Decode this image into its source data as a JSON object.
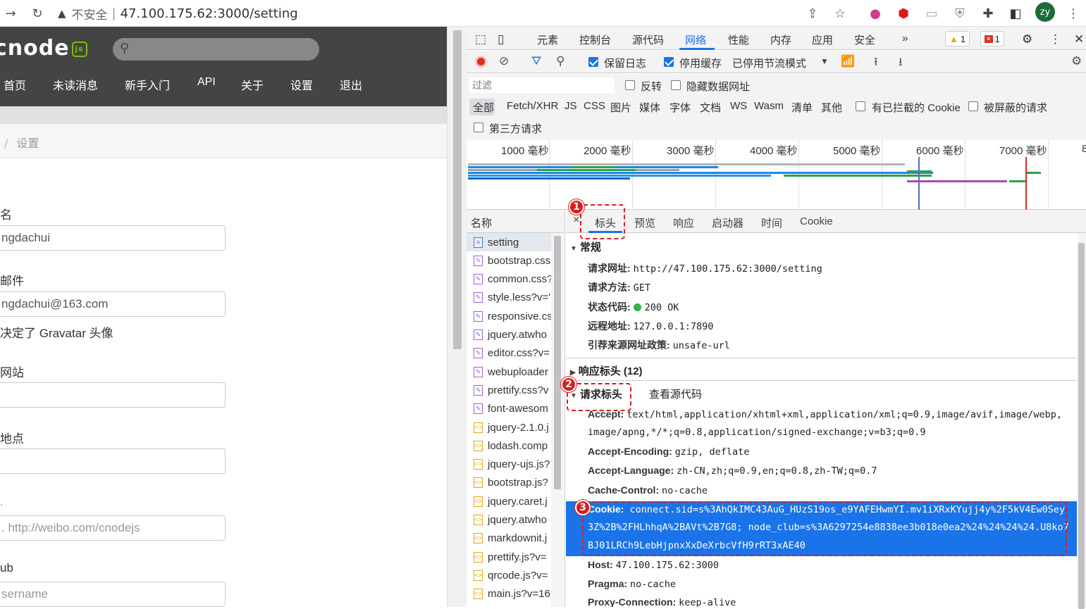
{
  "browser": {
    "insecure_label": "不安全",
    "url": "47.100.175.62:3000/setting",
    "profile_initials": "zy"
  },
  "cnode": {
    "logo": "cnode",
    "logo_js": "js",
    "nav": [
      "首页",
      "未读消息",
      "新手入门",
      "API",
      "关于",
      "设置",
      "退出"
    ],
    "breadcrumb_sep": "/",
    "breadcrumb": "设置",
    "fields": [
      {
        "label": "名",
        "value": "ngdachui",
        "placeholder": false
      },
      {
        "label": "邮件",
        "value": "ngdachui@163.com",
        "placeholder": false
      },
      {
        "label": "决定了 Gravatar 头像",
        "value": null,
        "placeholder": false
      },
      {
        "label": "网站",
        "value": "",
        "placeholder": false
      },
      {
        "label": "地点",
        "value": "",
        "placeholder": false
      },
      {
        "label": "",
        "value": ". http://weibo.com/cnodejs",
        "placeholder": true
      },
      {
        "label": "ub",
        "value": "sername",
        "placeholder": true
      }
    ]
  },
  "devtools": {
    "tabs": [
      "元素",
      "控制台",
      "源代码",
      "网络",
      "性能",
      "内存",
      "应用",
      "安全",
      "»"
    ],
    "active_tab": "网络",
    "warnings": "1",
    "errors": "1",
    "toolbar": {
      "preserve_log": "保留日志",
      "disable_cache": "停用缓存",
      "throttle": "已停用节流模式"
    },
    "filter": {
      "placeholder": "过滤",
      "invert": "反转",
      "hide_data_urls": "隐藏数据网址",
      "types": [
        "全部",
        "Fetch/XHR",
        "JS",
        "CSS",
        "图片",
        "媒体",
        "字体",
        "文档",
        "WS",
        "Wasm",
        "清单",
        "其他"
      ],
      "blocked_cookies": "有已拦截的 Cookie",
      "blocked_requests": "被屏蔽的请求",
      "third_party": "第三方请求"
    },
    "timeline_ticks": [
      "1000 毫秒",
      "2000 毫秒",
      "3000 毫秒",
      "4000 毫秒",
      "5000 毫秒",
      "6000 毫秒",
      "7000 毫秒",
      "8"
    ],
    "names_header": "名称",
    "requests": [
      {
        "name": "setting",
        "type": "doc"
      },
      {
        "name": "bootstrap.css",
        "type": "css"
      },
      {
        "name": "common.css?",
        "type": "css"
      },
      {
        "name": "style.less?v='",
        "type": "css"
      },
      {
        "name": "responsive.cs",
        "type": "css"
      },
      {
        "name": "jquery.atwho",
        "type": "css"
      },
      {
        "name": "editor.css?v=",
        "type": "css"
      },
      {
        "name": "webuploader",
        "type": "css"
      },
      {
        "name": "prettify.css?v",
        "type": "css"
      },
      {
        "name": "font-awesom",
        "type": "css"
      },
      {
        "name": "jquery-2.1.0.j",
        "type": "js"
      },
      {
        "name": "lodash.comp",
        "type": "js"
      },
      {
        "name": "jquery-ujs.js?",
        "type": "js"
      },
      {
        "name": "bootstrap.js?",
        "type": "js"
      },
      {
        "name": "jquery.caret.j",
        "type": "js"
      },
      {
        "name": "jquery.atwho",
        "type": "js"
      },
      {
        "name": "markdownit.j",
        "type": "js"
      },
      {
        "name": "prettify.js?v=",
        "type": "js"
      },
      {
        "name": "qrcode.js?v=",
        "type": "js"
      },
      {
        "name": "main.js?v=16",
        "type": "js"
      }
    ],
    "detail_tabs": [
      "×",
      "标头",
      "预览",
      "响应",
      "启动器",
      "时间",
      "Cookie"
    ],
    "general": {
      "title": "常规",
      "request_url_k": "请求网址:",
      "request_url_v": "http://47.100.175.62:3000/setting",
      "method_k": "请求方法:",
      "method_v": "GET",
      "status_k": "状态代码:",
      "status_v": "200 OK",
      "remote_k": "远程地址:",
      "remote_v": "127.0.0.1:7890",
      "referrer_k": "引荐来源网址政策:",
      "referrer_v": "unsafe-url"
    },
    "response_headers": "响应标头 (12)",
    "request_headers": "请求标头",
    "view_source": "查看源代码",
    "headers": {
      "accept_k": "Accept:",
      "accept_v1": "text/html,application/xhtml+xml,application/xml;q=0.9,image/avif,image/webp,",
      "accept_v2": "image/apng,*/*;q=0.8,application/signed-exchange;v=b3;q=0.9",
      "encoding_k": "Accept-Encoding:",
      "encoding_v": "gzip, deflate",
      "language_k": "Accept-Language:",
      "language_v": "zh-CN,zh;q=0.9,en;q=0.8,zh-TW;q=0.7",
      "cache_k": "Cache-Control:",
      "cache_v": "no-cache",
      "cookie_k": "Cookie:",
      "cookie_v1": "connect.sid=s%3AhQkIMC43AuG_HUzS19os_e9YAFEHwmYI.mv1iXRxKYujj4y%2F5kV4Ew0Sey",
      "cookie_v2": "3Z%2B%2FHLhhqA%2BAVt%2B7G8; node_club=s%3A6297254e8838ee3b018e0ea2%24%24%24%24.U8ko7",
      "cookie_v3": "BJ01LRCh9LebHjpnxXxDeXrbcVfH9rRT3xAE40",
      "host_k": "Host:",
      "host_v": "47.100.175.62:3000",
      "pragma_k": "Pragma:",
      "pragma_v": "no-cache",
      "proxy_k": "Proxy-Connection:",
      "proxy_v": "keep-alive"
    }
  },
  "annotations": [
    "1",
    "2",
    "3"
  ],
  "colors": {
    "accent": "#1a73e8",
    "annotation": "#d81e1e",
    "cnode_header": "#444444"
  }
}
